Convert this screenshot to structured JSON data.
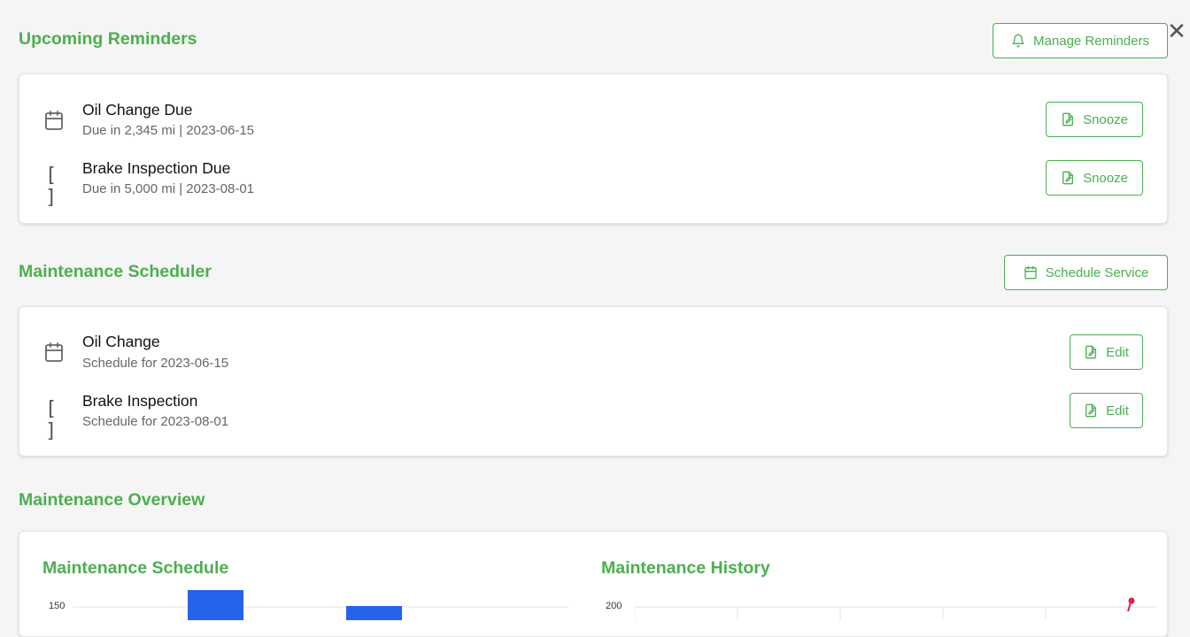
{
  "reminders": {
    "title": "Upcoming Reminders",
    "manage_label": "Manage Reminders",
    "items": [
      {
        "title": "Oil Change Due",
        "subtitle": "Due in 2,345 mi | 2023-06-15",
        "action": "Snooze",
        "icon": "calendar-icon"
      },
      {
        "title": "Brake Inspection Due",
        "subtitle": "Due in 5,000 mi | 2023-08-01",
        "action": "Snooze",
        "icon_text": "[ ]"
      }
    ]
  },
  "scheduler": {
    "title": "Maintenance Scheduler",
    "schedule_label": "Schedule Service",
    "items": [
      {
        "title": "Oil Change",
        "subtitle": "Schedule for 2023-06-15",
        "action": "Edit",
        "icon": "calendar-icon"
      },
      {
        "title": "Brake Inspection",
        "subtitle": "Schedule for 2023-08-01",
        "action": "Edit",
        "icon_text": "[ ]"
      }
    ]
  },
  "overview": {
    "title": "Maintenance Overview",
    "schedule_chart": {
      "title": "Maintenance Schedule",
      "y_tick_top": "150",
      "bar_color": "#2563eb"
    },
    "history_chart": {
      "title": "Maintenance History",
      "y_tick_top": "200",
      "line_color": "#e11d48"
    }
  },
  "close_label": "✕",
  "colors": {
    "accent": "#4caf50",
    "background": "#f5f5f5"
  }
}
